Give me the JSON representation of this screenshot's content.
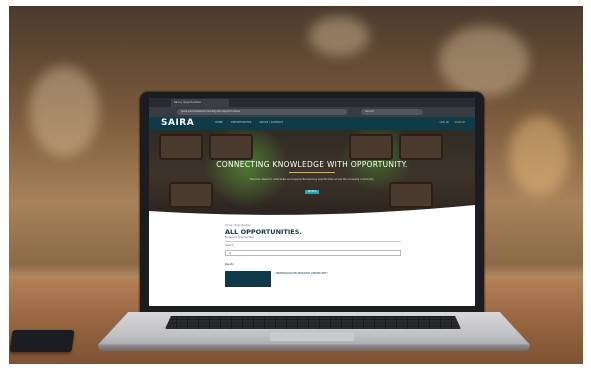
{
  "browser": {
    "tab_title": "Saira | Opportunities",
    "url": "saira.sacredheartuniversity.edu/opportunities",
    "search_placeholder": "Search"
  },
  "site": {
    "logo": "SAIRA",
    "nav_links": [
      "HOME",
      "OPPORTUNITIES",
      "ABOUT / CONTACT"
    ],
    "nav_right": [
      "LOG IN",
      "SIGN UP"
    ]
  },
  "hero": {
    "title": "CONNECTING KNOWLEDGE WITH OPPORTUNITY.",
    "subtitle": "Discover research, internships and experiential learning opportunities across the university community.",
    "button_label": "SEARCH"
  },
  "page": {
    "breadcrumb": "Home / Opportunities",
    "heading": "ALL OPPORTUNITIES.",
    "subheading": "Browse all opportunities",
    "filter_label": "Search",
    "filter_value": "Q",
    "results_label": "Results",
    "card_title": "UNDERGRADUATE RESEARCH OPPORTUNITY"
  },
  "colors": {
    "brand": "#0f3a47",
    "accent": "#21a7b4",
    "gold": "#d8b43a"
  }
}
